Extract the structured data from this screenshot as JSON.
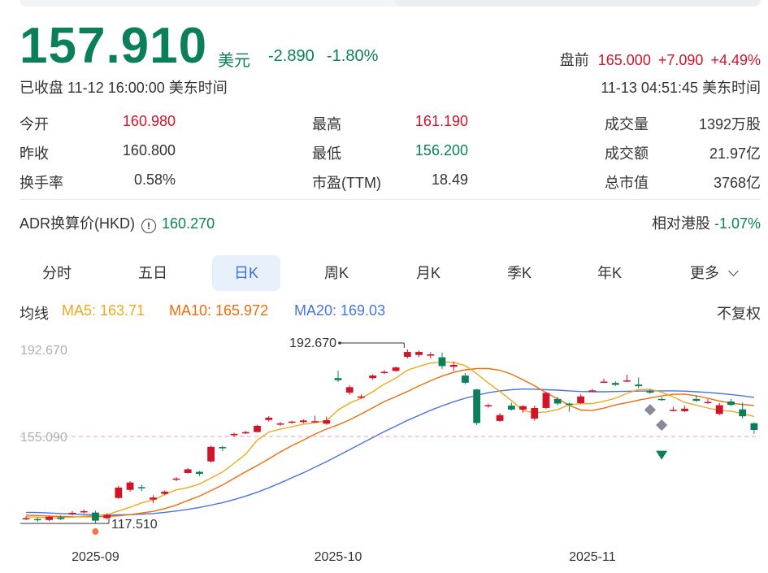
{
  "quote": {
    "price": "157.910",
    "currency": "美元",
    "change": "-2.890",
    "change_pct": "-1.80%",
    "closed_status": "已收盘 11-12 16:00:00 美东时间",
    "pre_label": "盘前",
    "pre_price": "165.000",
    "pre_change": "+7.090",
    "pre_pct": "+4.49%",
    "pre_time": "11-13 04:51:45 美东时间"
  },
  "stats": {
    "open_label": "今开",
    "open": "160.980",
    "prev_label": "昨收",
    "prev": "160.800",
    "turnover_label": "换手率",
    "turnover": "0.58%",
    "high_label": "最高",
    "high": "161.190",
    "low_label": "最低",
    "low": "156.200",
    "pe_label": "市盈(TTM)",
    "pe": "18.49",
    "volume_label": "成交量",
    "volume": "1392万股",
    "amount_label": "成交额",
    "amount": "21.97亿",
    "mcap_label": "总市值",
    "mcap": "3768亿"
  },
  "adr": {
    "label": "ADR换算价(HKD)",
    "info_icon": "info-circle-icon",
    "value": "160.270",
    "rel_label": "相对港股",
    "rel_value": "-1.07%"
  },
  "tabs": [
    "分时",
    "五日",
    "日K",
    "周K",
    "月K",
    "季K",
    "年K",
    "更多"
  ],
  "active_tab": "日K",
  "more_icon": "chevron-down-icon",
  "ma": {
    "label": "均线",
    "ma5": "MA5: 163.71",
    "ma10": "MA10: 165.972",
    "ma20": "MA20: 169.03",
    "adjust": "不复权"
  },
  "colors": {
    "up": "#d0142c",
    "down": "#0b7f5b",
    "ma5": "#f0a81c",
    "ma10": "#f06b0f",
    "ma20": "#4a73e0"
  },
  "chart_data": {
    "type": "candlestick",
    "y_axis_labels": [
      "192.670",
      "155.090"
    ],
    "ylim": [
      112,
      196
    ],
    "reference_line": 155.09,
    "high_marker": "192.670",
    "low_marker": "117.510",
    "x_labels": [
      "2025-09",
      "2025-10",
      "2025-11"
    ],
    "candles": [
      {
        "o": 119.6,
        "h": 120.6,
        "l": 118.9,
        "c": 119.8
      },
      {
        "o": 119.4,
        "h": 120.2,
        "l": 118.2,
        "c": 119.0
      },
      {
        "o": 119.0,
        "h": 120.9,
        "l": 118.5,
        "c": 120.4
      },
      {
        "o": 120.1,
        "h": 121.0,
        "l": 118.9,
        "c": 119.4
      },
      {
        "o": 121.6,
        "h": 122.9,
        "l": 121.0,
        "c": 122.1
      },
      {
        "o": 122.3,
        "h": 123.6,
        "l": 121.8,
        "c": 122.8
      },
      {
        "o": 122.2,
        "h": 123.0,
        "l": 117.5,
        "c": 118.7
      },
      {
        "o": 119.8,
        "h": 121.9,
        "l": 119.2,
        "c": 121.2
      },
      {
        "o": 128.5,
        "h": 133.8,
        "l": 128.2,
        "c": 133.0
      },
      {
        "o": 132.0,
        "h": 135.8,
        "l": 131.2,
        "c": 135.2
      },
      {
        "o": 133.2,
        "h": 134.2,
        "l": 131.5,
        "c": 132.9
      },
      {
        "o": 127.8,
        "h": 129.7,
        "l": 126.3,
        "c": 128.7
      },
      {
        "o": 130.3,
        "h": 131.8,
        "l": 129.7,
        "c": 131.2
      },
      {
        "o": 136.4,
        "h": 137.5,
        "l": 135.8,
        "c": 136.9
      },
      {
        "o": 139.3,
        "h": 141.4,
        "l": 139.0,
        "c": 140.9
      },
      {
        "o": 139.8,
        "h": 140.2,
        "l": 138.0,
        "c": 138.9
      },
      {
        "o": 144.3,
        "h": 151.2,
        "l": 143.7,
        "c": 150.6
      },
      {
        "o": 150.5,
        "h": 151.0,
        "l": 148.8,
        "c": 150.4
      },
      {
        "o": 155.6,
        "h": 156.7,
        "l": 155.0,
        "c": 156.2
      },
      {
        "o": 156.4,
        "h": 157.4,
        "l": 156.2,
        "c": 157.0
      },
      {
        "o": 157.0,
        "h": 160.2,
        "l": 156.8,
        "c": 159.7
      },
      {
        "o": 162.2,
        "h": 163.9,
        "l": 161.5,
        "c": 163.2
      },
      {
        "o": 160.2,
        "h": 161.4,
        "l": 159.7,
        "c": 160.7
      },
      {
        "o": 161.2,
        "h": 161.9,
        "l": 160.6,
        "c": 161.5
      },
      {
        "o": 161.3,
        "h": 162.5,
        "l": 160.8,
        "c": 162.0
      },
      {
        "o": 161.6,
        "h": 164.0,
        "l": 161.3,
        "c": 161.7
      },
      {
        "o": 160.6,
        "h": 163.7,
        "l": 160.1,
        "c": 162.1
      },
      {
        "o": 180.3,
        "h": 183.5,
        "l": 178.6,
        "c": 179.4
      },
      {
        "o": 174.0,
        "h": 177.2,
        "l": 173.1,
        "c": 176.4
      },
      {
        "o": 171.8,
        "h": 173.3,
        "l": 171.3,
        "c": 172.4
      },
      {
        "o": 180.3,
        "h": 182.0,
        "l": 179.5,
        "c": 181.4
      },
      {
        "o": 182.5,
        "h": 183.8,
        "l": 182.0,
        "c": 183.0
      },
      {
        "o": 183.4,
        "h": 185.3,
        "l": 183.0,
        "c": 184.9
      },
      {
        "o": 189.5,
        "h": 192.7,
        "l": 188.8,
        "c": 191.6
      },
      {
        "o": 190.3,
        "h": 192.2,
        "l": 189.4,
        "c": 191.6
      },
      {
        "o": 190.0,
        "h": 191.5,
        "l": 188.8,
        "c": 190.6
      },
      {
        "o": 189.3,
        "h": 191.3,
        "l": 184.2,
        "c": 185.5
      },
      {
        "o": 185.2,
        "h": 187.3,
        "l": 183.4,
        "c": 186.0
      },
      {
        "o": 181.4,
        "h": 182.5,
        "l": 177.6,
        "c": 178.3
      },
      {
        "o": 175.4,
        "h": 175.7,
        "l": 160.0,
        "c": 160.9
      },
      {
        "o": 168.4,
        "h": 169.2,
        "l": 167.5,
        "c": 168.6
      },
      {
        "o": 161.8,
        "h": 165.2,
        "l": 161.4,
        "c": 164.3
      },
      {
        "o": 168.4,
        "h": 169.7,
        "l": 166.3,
        "c": 166.7
      },
      {
        "o": 166.7,
        "h": 168.6,
        "l": 165.3,
        "c": 168.2
      },
      {
        "o": 162.8,
        "h": 168.4,
        "l": 161.9,
        "c": 167.4
      },
      {
        "o": 167.4,
        "h": 174.4,
        "l": 166.9,
        "c": 173.9
      },
      {
        "o": 171.3,
        "h": 172.1,
        "l": 168.5,
        "c": 169.3
      },
      {
        "o": 169.3,
        "h": 169.8,
        "l": 165.8,
        "c": 168.8
      },
      {
        "o": 169.5,
        "h": 173.4,
        "l": 169.2,
        "c": 172.4
      },
      {
        "o": 174.7,
        "h": 175.6,
        "l": 174.2,
        "c": 175.0
      },
      {
        "o": 178.6,
        "h": 180.1,
        "l": 178.2,
        "c": 178.8
      },
      {
        "o": 178.2,
        "h": 179.0,
        "l": 176.9,
        "c": 177.4
      },
      {
        "o": 179.0,
        "h": 181.8,
        "l": 178.6,
        "c": 179.3
      },
      {
        "o": 177.5,
        "h": 180.6,
        "l": 176.0,
        "c": 176.8
      },
      {
        "o": 174.6,
        "h": 175.4,
        "l": 173.6,
        "c": 174.0
      },
      {
        "o": 171.3,
        "h": 172.2,
        "l": 170.5,
        "c": 171.0
      },
      {
        "o": 166.6,
        "h": 167.9,
        "l": 165.9,
        "c": 166.6
      },
      {
        "o": 166.0,
        "h": 168.4,
        "l": 165.6,
        "c": 167.1
      },
      {
        "o": 171.3,
        "h": 172.8,
        "l": 170.1,
        "c": 170.5
      },
      {
        "o": 169.5,
        "h": 171.3,
        "l": 169.1,
        "c": 170.0
      },
      {
        "o": 164.8,
        "h": 169.6,
        "l": 164.3,
        "c": 168.6
      },
      {
        "o": 170.2,
        "h": 171.3,
        "l": 168.2,
        "c": 168.7
      },
      {
        "o": 166.8,
        "h": 169.8,
        "l": 162.9,
        "c": 163.8
      },
      {
        "o": 160.8,
        "h": 161.2,
        "l": 156.2,
        "c": 157.9
      }
    ],
    "gray_markers": [
      {
        "i": 54,
        "v": 166.6
      },
      {
        "i": 55,
        "v": 160.0
      }
    ],
    "down_arrow_marker": {
      "i": 55,
      "v": 146.8
    },
    "low_dot_marker": {
      "i": 6,
      "v": 117.5
    },
    "ma5": [
      120.4,
      120.2,
      120.0,
      120.0,
      120.2,
      120.6,
      121.0,
      121.3,
      122.9,
      124.5,
      126.4,
      127.6,
      130.0,
      132.0,
      133.0,
      134.5,
      137.1,
      139.7,
      143.5,
      147.4,
      153.5,
      157.0,
      158.3,
      159.3,
      160.4,
      161.0,
      161.9,
      166.5,
      169.5,
      171.6,
      174.4,
      177.7,
      180.3,
      183.7,
      185.4,
      186.8,
      187.3,
      187.1,
      185.7,
      182.2,
      178.2,
      174.5,
      170.6,
      166.3,
      165.3,
      165.7,
      166.7,
      168.8,
      169.2,
      169.3,
      170.3,
      171.6,
      173.7,
      175.4,
      175.5,
      174.2,
      172.2,
      169.8,
      168.6,
      167.4,
      166.3,
      166.0,
      165.0,
      163.7
    ],
    "ma10": [
      121.1,
      120.9,
      120.7,
      120.5,
      120.4,
      120.4,
      120.4,
      120.5,
      120.8,
      121.3,
      122.0,
      122.7,
      123.9,
      125.5,
      127.4,
      129.3,
      131.7,
      134.1,
      137.0,
      139.8,
      142.5,
      145.4,
      148.4,
      151.1,
      153.5,
      156.1,
      158.3,
      160.1,
      162.3,
      164.8,
      167.5,
      170.2,
      172.3,
      174.5,
      176.9,
      179.2,
      181.2,
      182.8,
      183.9,
      184.4,
      184.4,
      183.7,
      182.0,
      179.6,
      177.0,
      174.0,
      171.3,
      168.6,
      166.5,
      166.3,
      167.3,
      168.7,
      169.7,
      170.8,
      171.7,
      172.6,
      173.3,
      173.4,
      172.6,
      171.6,
      170.4,
      169.5,
      168.9,
      168.5
    ],
    "ma20": [
      122.3,
      122.2,
      122.0,
      121.8,
      121.6,
      121.4,
      121.2,
      121.1,
      121.2,
      121.3,
      121.5,
      121.8,
      122.3,
      122.9,
      123.6,
      124.4,
      125.4,
      126.5,
      127.8,
      129.3,
      131.0,
      132.9,
      135.0,
      137.2,
      139.4,
      141.8,
      144.2,
      146.8,
      149.4,
      152.0,
      154.6,
      157.2,
      159.6,
      162.0,
      164.2,
      166.4,
      168.3,
      170.1,
      171.6,
      172.9,
      174.0,
      174.8,
      175.3,
      175.6,
      175.5,
      175.3,
      175.1,
      174.8,
      174.5,
      174.4,
      174.4,
      174.5,
      174.6,
      174.7,
      174.8,
      174.8,
      174.8,
      174.7,
      174.4,
      174.1,
      173.7,
      173.2,
      172.6,
      172.0
    ]
  }
}
